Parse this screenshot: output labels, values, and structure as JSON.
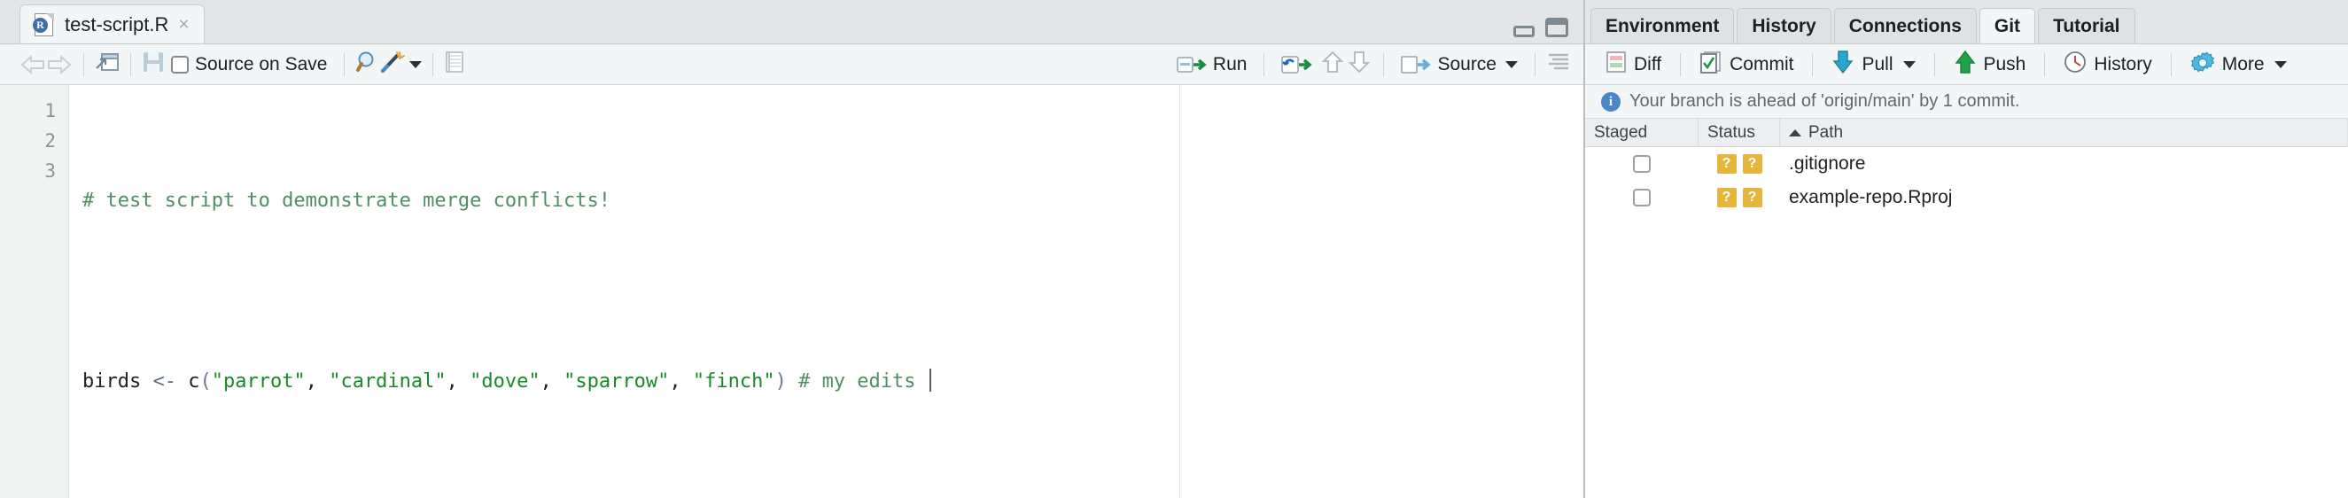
{
  "source_pane": {
    "tab": {
      "title": "test-script.R",
      "icon": "r-file-icon",
      "close": "×",
      "letter": "R"
    },
    "pane_controls": {
      "minimize": "minimize-pane-icon",
      "maximize": "maximize-pane-icon"
    },
    "toolbar": {
      "back": "back-arrow-icon",
      "forward": "forward-arrow-icon",
      "popout": "show-in-new-window-icon",
      "save": "save-icon",
      "source_on_save_label": "Source on Save",
      "find": "find-replace-icon",
      "code_tools": "magic-wand-icon",
      "compile_report": "compile-report-icon",
      "run_label": "Run",
      "rerun": "rerun-icon",
      "prev_chunk": "up-arrow-icon",
      "next_chunk": "down-arrow-icon",
      "source_label": "Source",
      "outline": "document-outline-icon"
    },
    "editor": {
      "line_numbers": [
        "1",
        "2",
        "3"
      ],
      "lines": [
        {
          "comment": "# test script to demonstrate merge conflicts!"
        },
        {
          "blank": ""
        },
        {
          "var": "birds",
          "assign": "<-",
          "fn": "c",
          "open": "(",
          "s1": "\"parrot\"",
          "sep1": ", ",
          "s2": "\"cardinal\"",
          "sep2": ", ",
          "s3": "\"dove\"",
          "sep3": ", ",
          "s4": "\"sparrow\"",
          "sep4": ", ",
          "s5": "\"finch\"",
          "close": ")",
          "trailing_comment": " # my edits "
        }
      ]
    }
  },
  "right_pane": {
    "tabs": [
      {
        "label": "Environment",
        "active": false
      },
      {
        "label": "History",
        "active": false
      },
      {
        "label": "Connections",
        "active": false
      },
      {
        "label": "Git",
        "active": true
      },
      {
        "label": "Tutorial",
        "active": false
      }
    ],
    "git_toolbar": {
      "diff_label": "Diff",
      "diff_icon": "diff-icon",
      "commit_label": "Commit",
      "commit_icon": "commit-checklist-icon",
      "pull_label": "Pull",
      "pull_icon": "pull-down-arrow-icon",
      "push_label": "Push",
      "push_icon": "push-up-arrow-icon",
      "history_label": "History",
      "history_icon": "clock-icon",
      "more_label": "More",
      "more_icon": "gear-icon"
    },
    "branch_status": {
      "icon": "info-icon",
      "message": "Your branch is ahead of 'origin/main' by 1 commit."
    },
    "file_table": {
      "columns": {
        "staged": "Staged",
        "status": "Status",
        "path": "Path"
      },
      "sort": "ascending",
      "rows": [
        {
          "staged": false,
          "status_left": "?",
          "status_right": "?",
          "path": ".gitignore"
        },
        {
          "staged": false,
          "status_left": "?",
          "status_right": "?",
          "path": "example-repo.Rproj"
        }
      ]
    }
  },
  "colors": {
    "untracked_badge": "#e5b53c",
    "pull_arrow": "#2aa8cc",
    "push_arrow": "#22a04a",
    "run_arrow": "#1d8a45",
    "info_blue": "#4a87c8",
    "comment_green": "#4f8f63",
    "string_green": "#1a8a28"
  }
}
